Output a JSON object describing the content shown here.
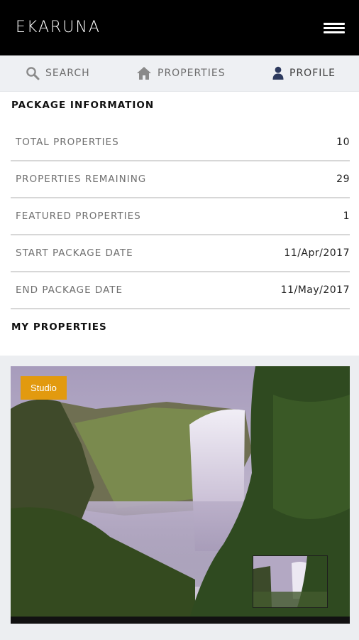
{
  "header": {
    "logo_text": "EKARUNA"
  },
  "tabs": [
    {
      "label": "SEARCH",
      "icon": "search-icon"
    },
    {
      "label": "PROPERTIES",
      "icon": "home-icon"
    },
    {
      "label": "PROFILE",
      "icon": "user-icon"
    }
  ],
  "package": {
    "title": "PACKAGE INFORMATION",
    "rows": [
      {
        "label": "TOTAL PROPERTIES",
        "value": "10"
      },
      {
        "label": "PROPERTIES REMAINING",
        "value": "29"
      },
      {
        "label": "FEATURED PROPERTIES",
        "value": "1"
      },
      {
        "label": "START PACKAGE DATE",
        "value": "11/Apr/2017"
      },
      {
        "label": "END PACKAGE DATE",
        "value": "11/May/2017"
      }
    ]
  },
  "my_properties": {
    "title": "MY PROPERTIES",
    "card": {
      "badge": "Studio"
    }
  },
  "colors": {
    "header_bg": "#000000",
    "tab_bg": "#eef0f3",
    "badge": "#e29a0f",
    "profile_icon": "#2d3a5e"
  }
}
